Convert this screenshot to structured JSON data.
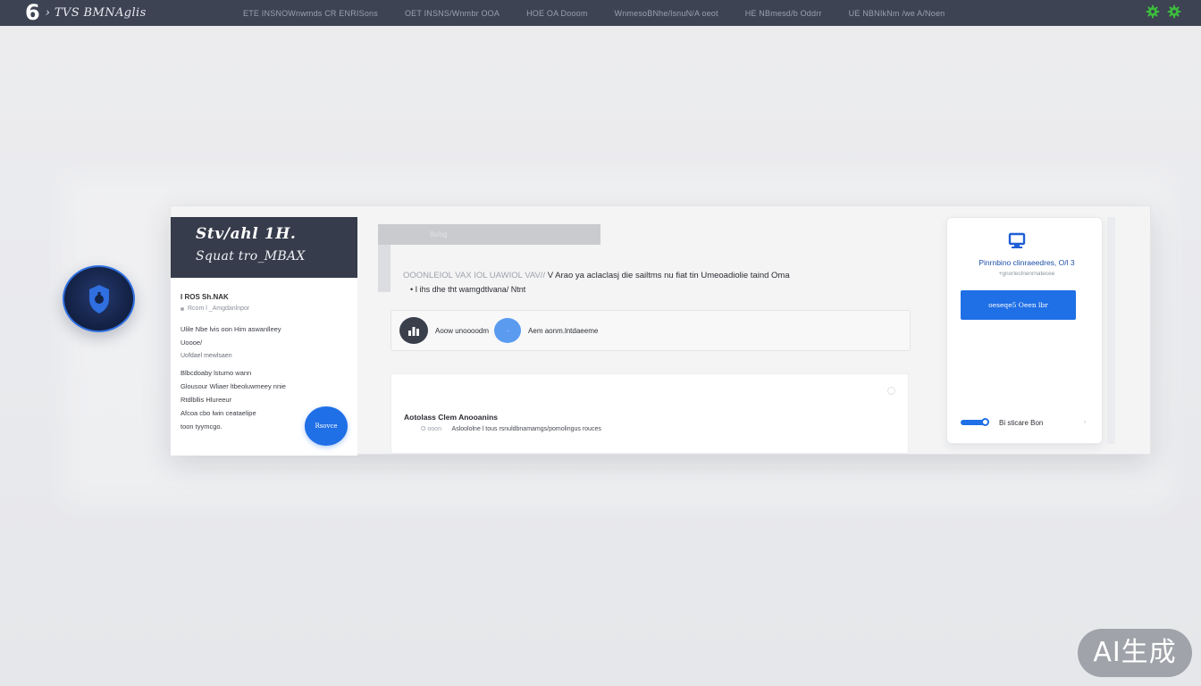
{
  "topbar": {
    "logo": "6",
    "brand": "› TVS BMNAglis",
    "nav": [
      "ETE INSNOWnwmds   CR ENRISons",
      "OET INSNS/Wnmbr OOA",
      "HOE OA Dooom",
      "WnmesoBNhe/lsnuN/A oeot",
      "HE NBmesd/b Oddrr",
      "UE NBNIkNm /we A/Noen"
    ]
  },
  "left_panel": {
    "title": "Stv/ahl 1H.",
    "subtitle": "Squat tro_MBAX",
    "body": {
      "line1": "I ROS Sh.NAK",
      "line2": "Rcom l _Amgdanlnpor",
      "para1": "Ulile Nbe lvis oon Him aswanlleey",
      "para2": "Uoooe/",
      "para3": "Uofdael mewlsaen",
      "para4": "Blbcdoaby lstumo wann",
      "para5": "Glousour Wliaer ltbeoluwmeey nnie",
      "para6": "Rtdlbllis Hlureeur",
      "para7": "Afcoa cbo lwin ceataelipe",
      "para8": "toon tyymcgo."
    },
    "button_label": "Rsovce"
  },
  "main": {
    "tab_label": "Ilo/og",
    "headline_faint": "OOONLEIOL VAX IOL UAWIOL VAV//",
    "headline": "V Arao ya aclaclasj die sailtms nu fiat tin Umeoadiolie taind Oma",
    "headline_2": "• I ihs dhe tht wamgdtlvana/ Ntnt",
    "pills": [
      {
        "label": "Aoow unoooodm"
      },
      {
        "label": "Aem aonm.lntdaeeme"
      }
    ],
    "activity": {
      "title": "Aotolass Clem Anooanins",
      "meta_faint": "O ooon",
      "meta": "Asloololne l tous rsnuldbnamamgs/pomolingus rouces"
    }
  },
  "right_panel": {
    "title": "Pinrnbino clinraeedres, O/l 3",
    "subtitle": "+gnorleclnenrnatecee",
    "button_label": "oeseqe5 Oeen lbr",
    "footer_label": "Bi sticare Bon",
    "footer_chevron": "›"
  },
  "watermark": "AI生成",
  "colors": {
    "accent": "#1f6fe6",
    "topbar": "#3d4353",
    "panel_header": "#363c4b",
    "gear": "#3dbb3d"
  },
  "icons": {
    "badge": "shield-icon",
    "top_right": [
      "gear-icon",
      "gear-icon"
    ],
    "right_panel": "monitor-icon"
  }
}
